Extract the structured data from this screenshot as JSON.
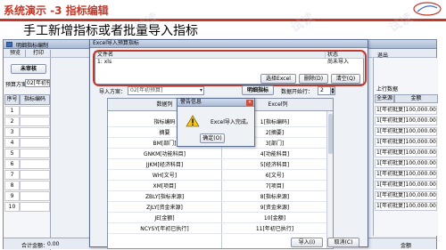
{
  "slide": {
    "title": "系统演示 -3 指标编辑",
    "subtitle": "手工新增指标或者批量导入指标"
  },
  "app": {
    "title": "明细指标编制",
    "toolbar": [
      "预览",
      "打印"
    ],
    "status_text": "审核状态：未审核",
    "unreviewed_label": "未审核",
    "plan_label": "预算方案",
    "plan_value": "02[年初预算]",
    "grid_headers": [
      "序号",
      "指标编码"
    ],
    "row_numbers": [
      "1",
      "2",
      "3",
      "4",
      "5",
      "6",
      "7",
      "8",
      "9",
      "10"
    ],
    "total_label": "合计金额：",
    "total_value": "0.00",
    "right_toolbar_label": "退出",
    "right_header": "上行数据",
    "right_col_a": "全来源",
    "right_col_b": "金额",
    "right_rows": [
      "1[年初批复]100,000.00",
      "1[年初批复]100,000.00",
      "1[年初批复]100,000.00",
      "1[年初批复]100,000.00",
      "1[年初批复]100,000.00",
      "1[年初批复]100,000.00",
      "1[年初批复]100,000.00",
      "1[年初批复]100,000.00",
      "1[年初批复]100,000.00",
      "1[年初批复]100,000.00"
    ]
  },
  "import_dialog": {
    "title": "Excel导入预算指标",
    "file_col": "文件名",
    "status_col": "状态",
    "file_row": "1: xls",
    "status_value": "尚未导入",
    "select_excel": "选择Excel",
    "delete": "删除(D)",
    "clear": "清空(Q)",
    "import_plan_label": "导入方案：",
    "import_plan_value": "02[年初预算]",
    "mapping_button": "明细指标",
    "data_start_label": "数据开始行：",
    "data_start_value": "2",
    "col_data": "数据列",
    "col_excel": "Excel列",
    "rows": [
      {
        "field": "指标编码",
        "col": "1[指标编码]"
      },
      {
        "field": "摘要",
        "col": "2[摘要]"
      },
      {
        "field": "BM[部门]",
        "col": "3[部门]"
      },
      {
        "field": "GNKM[功能科目]",
        "col": "4[功能科目]"
      },
      {
        "field": "JJKM[经济科目]",
        "col": "5[经济科目]"
      },
      {
        "field": "WH[文号]",
        "col": "6[文号]"
      },
      {
        "field": "XM[项目]",
        "col": "7[项目]"
      },
      {
        "field": "ZBLY[指标来源]",
        "col": "8[指标来源]"
      },
      {
        "field": "ZJLY[资金来源]",
        "col": "9[资金来源]"
      },
      {
        "field": "JE[金额]",
        "col": "10[金额]"
      },
      {
        "field": "NCYSY[年初已执行]",
        "col": "11[年初已执行]"
      }
    ],
    "import_button": "导入(I)",
    "cancel_button": "取消(C)"
  },
  "alert": {
    "title": "警告信息",
    "close": "×",
    "message": "Excel导入完成。",
    "ok": "确定(O)"
  },
  "watermark": "试读",
  "colors": {
    "accent_red": "#c0392b",
    "window_blue": "#aab9d4"
  }
}
